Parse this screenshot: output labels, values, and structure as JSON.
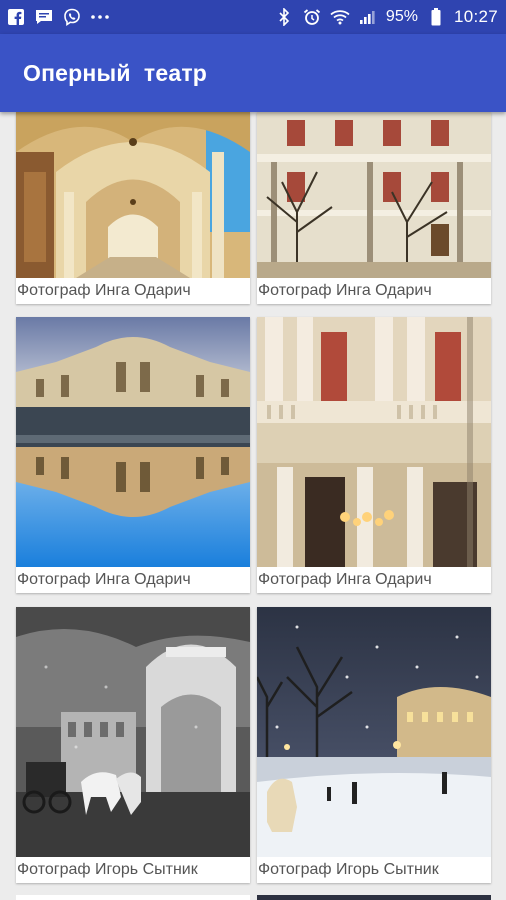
{
  "status_bar": {
    "time": "10:27",
    "battery": "95%",
    "left_icons": [
      "facebook-icon",
      "chat-icon",
      "viber-icon",
      "more-dots-icon"
    ],
    "right_icons": [
      "bluetooth-icon",
      "alarm-icon",
      "wifi-icon",
      "signal-icon",
      "battery-icon"
    ]
  },
  "app_bar": {
    "title": "Оперный  театр"
  },
  "gallery": {
    "items": [
      {
        "caption": "Фотограф Инга Одарич",
        "image": "opera-interior-arches-photo"
      },
      {
        "caption": "Фотограф Инга Одарич",
        "image": "opera-facade-trees-photo"
      },
      {
        "caption": "Фотограф Инга Одарич",
        "image": "opera-reflection-photo"
      },
      {
        "caption": "Фотограф Инга Одарич",
        "image": "opera-balcony-lamps-photo"
      },
      {
        "caption": "Фотограф Игорь Сытник",
        "image": "opera-bw-carriage-photo"
      },
      {
        "caption": "Фотограф Игорь Сытник",
        "image": "opera-winter-night-photo"
      }
    ]
  },
  "colors": {
    "status_bar": "#2f44b0",
    "app_bar": "#3a53c6",
    "background": "#ececec"
  }
}
